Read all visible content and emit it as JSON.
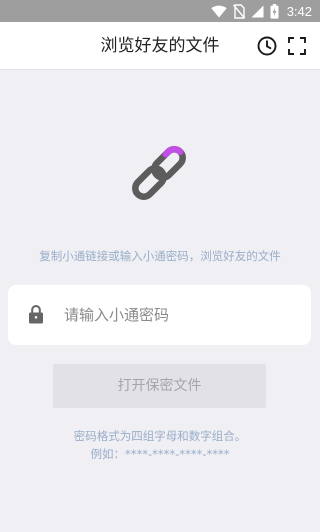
{
  "status_bar": {
    "time": "3:42",
    "icons": [
      "wifi-icon",
      "no-sim-icon",
      "signal-icon",
      "battery-charging-icon"
    ]
  },
  "header": {
    "title": "浏览好友的文件",
    "actions": [
      "history-icon",
      "fullscreen-icon"
    ]
  },
  "main": {
    "hero_icon": "link-icon",
    "hint": "复制小通链接或输入小通密码，浏览好友的文件",
    "code_field": {
      "placeholder": "请输入小通密码",
      "value": "",
      "icon": "lock-icon"
    },
    "open_button_label": "打开保密文件",
    "format_note": "密码格式为四组字母和数字组合。",
    "format_example": "例如：****-****-****-****"
  },
  "colors": {
    "background": "#efeff4",
    "status_bar": "#9e9e9e",
    "accent": "#c14fe6",
    "link_gray": "#5c5c5c",
    "hint_text": "#9aaec8",
    "button_disabled_bg": "#e2e2e6",
    "button_disabled_text": "#a6a6aa"
  }
}
